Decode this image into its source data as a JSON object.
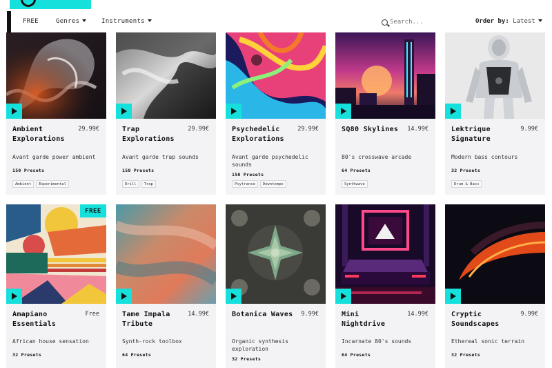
{
  "nav": {
    "items": [
      "FREE",
      "Genres",
      "Instruments"
    ],
    "search_placeholder": "Search...",
    "order_label": "Order by:",
    "order_value": "Latest"
  },
  "cards": [
    {
      "title": "Ambient Explorations",
      "price": "29.99€",
      "desc": "Avant garde power ambient",
      "presets": "150 Presets",
      "tags": [
        "Ambient",
        "Experimental"
      ]
    },
    {
      "title": "Trap Explorations",
      "price": "29.99€",
      "desc": "Avant garde trap sounds",
      "presets": "150 Presets",
      "tags": [
        "Drill",
        "Trap"
      ]
    },
    {
      "title": "Psychedelic Explorations",
      "price": "29.99€",
      "desc": "Avant garde psychedelic sounds",
      "presets": "150 Presets",
      "tags": [
        "Psytrance",
        "Downtempo"
      ]
    },
    {
      "title": "SQ80 Skylines",
      "price": "14.99€",
      "desc": "80's crosswave arcade",
      "presets": "64 Presets",
      "tags": [
        "Synthwave"
      ]
    },
    {
      "title": "Lektrique Signature",
      "price": "9.99€",
      "desc": "Modern bass contours",
      "presets": "32 Presets",
      "tags": [
        "Drum & Bass"
      ]
    },
    {
      "title": "Amapiano Essentials",
      "price": "Free",
      "desc": "African house sensation",
      "presets": "32 Presets",
      "tags": [],
      "badge": "FREE"
    },
    {
      "title": "Tame Impala Tribute",
      "price": "14.99€",
      "desc": "Synth-rock toolbox",
      "presets": "64 Presets",
      "tags": []
    },
    {
      "title": "Botanica Waves",
      "price": "9.99€",
      "desc": "Organic synthesis exploration",
      "presets": "32 Presets",
      "tags": []
    },
    {
      "title": "Mini Nightdrive",
      "price": "14.99€",
      "desc": "Incarnate 80's sounds",
      "presets": "64 Presets",
      "tags": []
    },
    {
      "title": "Cryptic Soundscapes",
      "price": "9.99€",
      "desc": "Ethereal sonic terrain",
      "presets": "32 Presets",
      "tags": []
    }
  ],
  "colors": {
    "accent": "#16e0dc"
  }
}
